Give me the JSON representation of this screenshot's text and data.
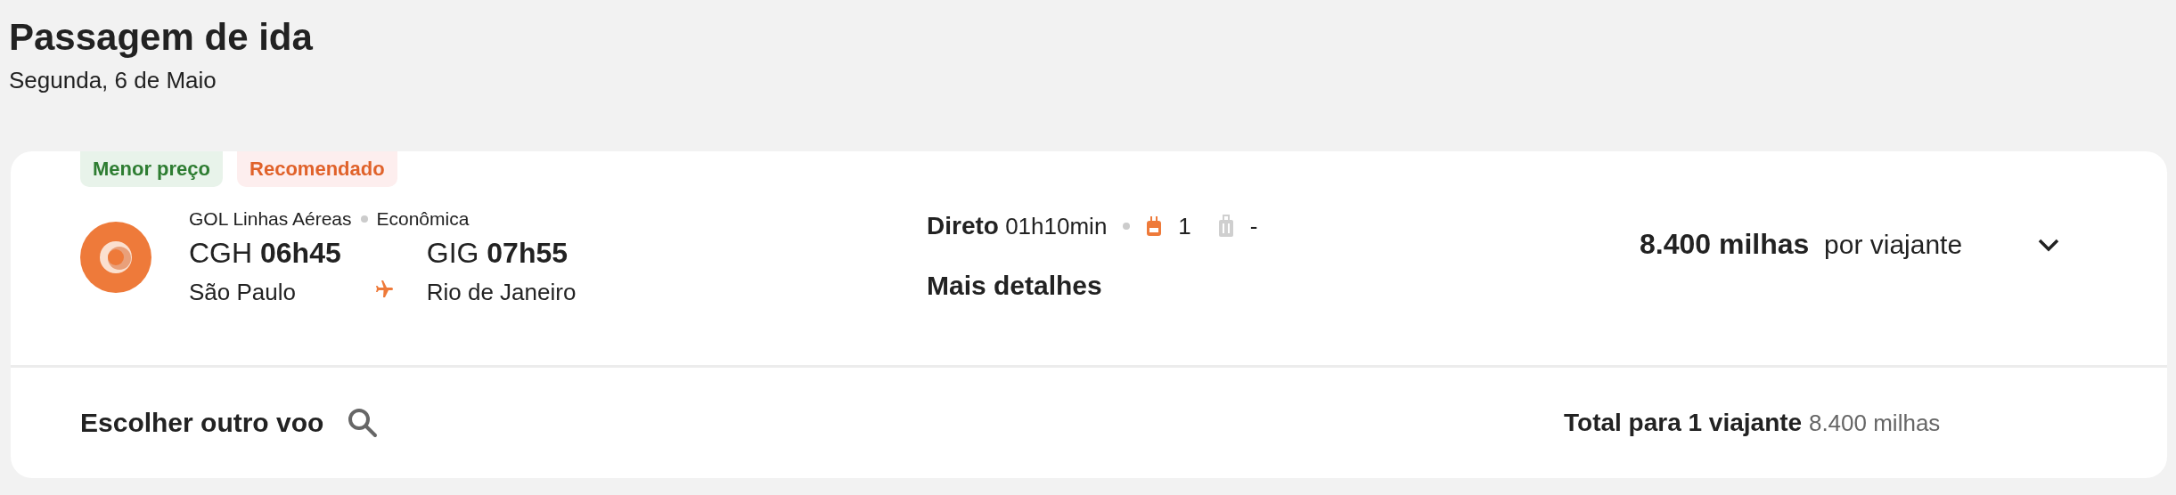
{
  "header": {
    "title": "Passagem de ida",
    "date": "Segunda, 6 de Maio"
  },
  "flight": {
    "badges": [
      {
        "label": "Menor preço",
        "kind": "price"
      },
      {
        "label": "Recomendado",
        "kind": "recommended"
      }
    ],
    "airline": "GOL Linhas Aéreas",
    "cabin": "Econômica",
    "departure": {
      "code": "CGH",
      "time": "06h45",
      "city": "São Paulo"
    },
    "arrival": {
      "code": "GIG",
      "time": "07h55",
      "city": "Rio de Janeiro"
    },
    "stops": "Direto",
    "duration": "01h10min",
    "baggage": [
      {
        "kind": "backpack",
        "included": true,
        "count": "1"
      },
      {
        "kind": "suitcase",
        "included": false,
        "count": "-"
      }
    ],
    "details_link": "Mais detalhes",
    "price": "8.400 milhas",
    "price_note": "por viajante",
    "expanded": false
  },
  "footer": {
    "other_flight": "Escolher outro voo",
    "total_label": "Total para 1 viajante",
    "total_value": "8.400 milhas"
  }
}
